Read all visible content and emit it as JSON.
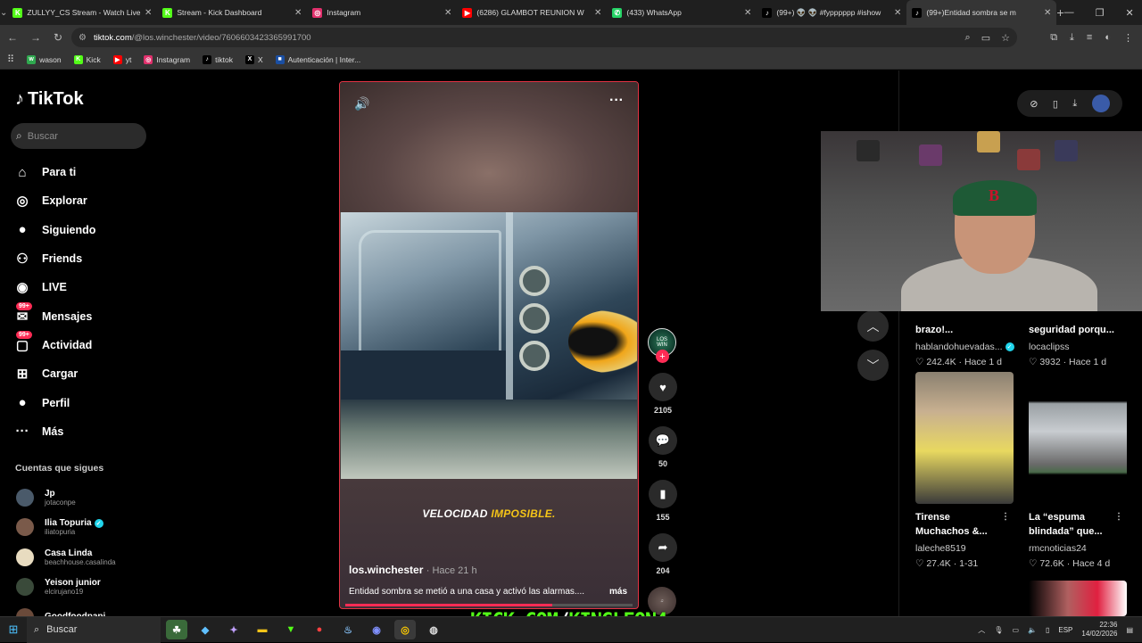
{
  "browser": {
    "tabs": [
      {
        "title": "ZULLYY_CS Stream - Watch Live",
        "icon": "kick-icon",
        "color": "#53fc18",
        "glyph": "K",
        "active": false
      },
      {
        "title": "Stream - Kick Dashboard",
        "icon": "kick-icon",
        "color": "#53fc18",
        "glyph": "K",
        "active": false
      },
      {
        "title": "Instagram",
        "icon": "instagram-icon",
        "color": "#e1306c",
        "glyph": "◎",
        "active": false
      },
      {
        "title": "(6286) GLAMBOT REUNION W",
        "icon": "youtube-icon",
        "color": "#ff0000",
        "glyph": "▶",
        "active": false
      },
      {
        "title": "(433) WhatsApp",
        "icon": "whatsapp-icon",
        "color": "#25d366",
        "glyph": "✆",
        "active": false
      },
      {
        "title": "(99+) 👽 👽 #fypppppp #ishow",
        "icon": "tiktok-icon",
        "color": "#000000",
        "glyph": "♪",
        "active": false
      },
      {
        "title": "(99+)Entidad sombra se m",
        "icon": "tiktok-icon",
        "color": "#000000",
        "glyph": "♪",
        "active": true
      }
    ],
    "url_domain": "tiktok.com",
    "url_path": "/@los.winchester/video/7606603423365991700",
    "bookmarks": [
      {
        "label": "wason",
        "icon": "wason-icon",
        "color": "#2fa84f",
        "glyph": "w"
      },
      {
        "label": "Kick",
        "icon": "kick-icon",
        "color": "#53fc18",
        "glyph": "K"
      },
      {
        "label": "yt",
        "icon": "youtube-icon",
        "color": "#ff0000",
        "glyph": "▶"
      },
      {
        "label": "Instagram",
        "icon": "instagram-icon",
        "color": "#e1306c",
        "glyph": "◎"
      },
      {
        "label": "tiktok",
        "icon": "tiktok-icon",
        "color": "#000000",
        "glyph": "♪"
      },
      {
        "label": "X",
        "icon": "x-icon",
        "color": "#000000",
        "glyph": "X"
      },
      {
        "label": "Autenticación | Inter...",
        "icon": "auth-icon",
        "color": "#1a4fa3",
        "glyph": "■"
      }
    ]
  },
  "sidebar": {
    "brand": "TikTok",
    "search_placeholder": "Buscar",
    "nav": [
      {
        "label": "Para ti",
        "icon": "home-icon",
        "glyph": "⌂"
      },
      {
        "label": "Explorar",
        "icon": "compass-icon",
        "glyph": "◎"
      },
      {
        "label": "Siguiendo",
        "icon": "following-icon",
        "glyph": "●"
      },
      {
        "label": "Friends",
        "icon": "friends-icon",
        "glyph": "⚇"
      },
      {
        "label": "LIVE",
        "icon": "live-icon",
        "glyph": "◉"
      },
      {
        "label": "Mensajes",
        "icon": "messages-icon",
        "glyph": "✉",
        "badge": "99+"
      },
      {
        "label": "Actividad",
        "icon": "activity-icon",
        "glyph": "▢",
        "badge": "99+"
      },
      {
        "label": "Cargar",
        "icon": "upload-icon",
        "glyph": "⊞"
      },
      {
        "label": "Perfil",
        "icon": "profile-icon",
        "glyph": "●"
      },
      {
        "label": "Más",
        "icon": "more-icon",
        "glyph": "···"
      }
    ],
    "following_title": "Cuentas que sigues",
    "following": [
      {
        "name": "Jp",
        "handle": "jotaconpe",
        "color": "#4a5a6a",
        "verified": false
      },
      {
        "name": "Ilia Topuria",
        "handle": "iliatopuria",
        "color": "#7a5a4a",
        "verified": true
      },
      {
        "name": "Casa Linda",
        "handle": "beachhouse.casalinda",
        "color": "#e8dcc0",
        "verified": false
      },
      {
        "name": "Yeison junior",
        "handle": "elcirujano19",
        "color": "#3a4a3a",
        "verified": false
      },
      {
        "name": "Goodfoodpapi",
        "handle": "",
        "color": "#6a4a3a",
        "verified": false
      }
    ]
  },
  "video": {
    "caption_plain": "VELOCIDAD",
    "caption_highlight": "IMPOSIBLE.",
    "author": "los.winchester",
    "time": "· Hace 21 h",
    "description": "Entidad sombra se metió a una casa y activó las alarmas....",
    "more_label": "más",
    "progress": 0.72,
    "actions": {
      "likes": "2105",
      "comments": "50",
      "saves": "155",
      "shares": "204"
    }
  },
  "recommended": [
    {
      "title": "brazo!...",
      "author": "hablandohuevadas...",
      "verified": true,
      "likes": "242.4K",
      "time": "Hace 1 d"
    },
    {
      "title": "seguridad porqu...",
      "author": "locaclipss",
      "verified": false,
      "likes": "3932",
      "time": "Hace 1 d"
    },
    {
      "title": "Tirense\nMuchachos &...",
      "author": "laleche8519",
      "verified": false,
      "likes": "27.4K",
      "time": "1-31"
    },
    {
      "title": "La “espuma\nblindada” que...",
      "author": "rmcnoticias24",
      "verified": false,
      "likes": "72.6K",
      "time": "Hace 4 d"
    }
  ],
  "overlay": {
    "kick_domain": "KICK.COM",
    "kick_slash": "/",
    "kick_user": "KINGLEON4"
  },
  "taskbar": {
    "search_placeholder": "Buscar",
    "lang": "ESP",
    "time": "22:36",
    "date": "14/02/2026"
  }
}
